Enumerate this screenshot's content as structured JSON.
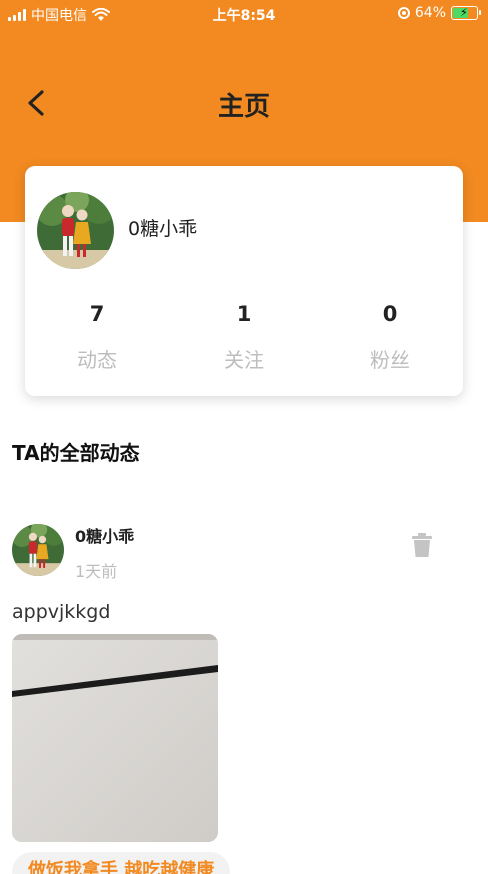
{
  "status_bar": {
    "carrier": "中国电信",
    "time": "上午8:54",
    "battery": "64%",
    "battery_level": 0.64,
    "icons": [
      "signal-icon",
      "wifi-icon",
      "orientation-lock-icon",
      "battery-icon"
    ]
  },
  "nav": {
    "title": "主页",
    "back_icon": "chevron-left-icon"
  },
  "profile": {
    "name": "0糖小乖",
    "stats": [
      {
        "value": "7",
        "label": "动态"
      },
      {
        "value": "1",
        "label": "关注"
      },
      {
        "value": "0",
        "label": "粉丝"
      }
    ]
  },
  "section": {
    "title": "TA的全部动态"
  },
  "post": {
    "user": "0糖小乖",
    "time": "1天前",
    "text": "appvjkkgd",
    "delete_icon": "trash-icon",
    "tag": "做饭我拿手 越吃越健康"
  },
  "colors": {
    "accent": "#F28A21",
    "muted": "#BDBDBD",
    "text": "#222222"
  }
}
